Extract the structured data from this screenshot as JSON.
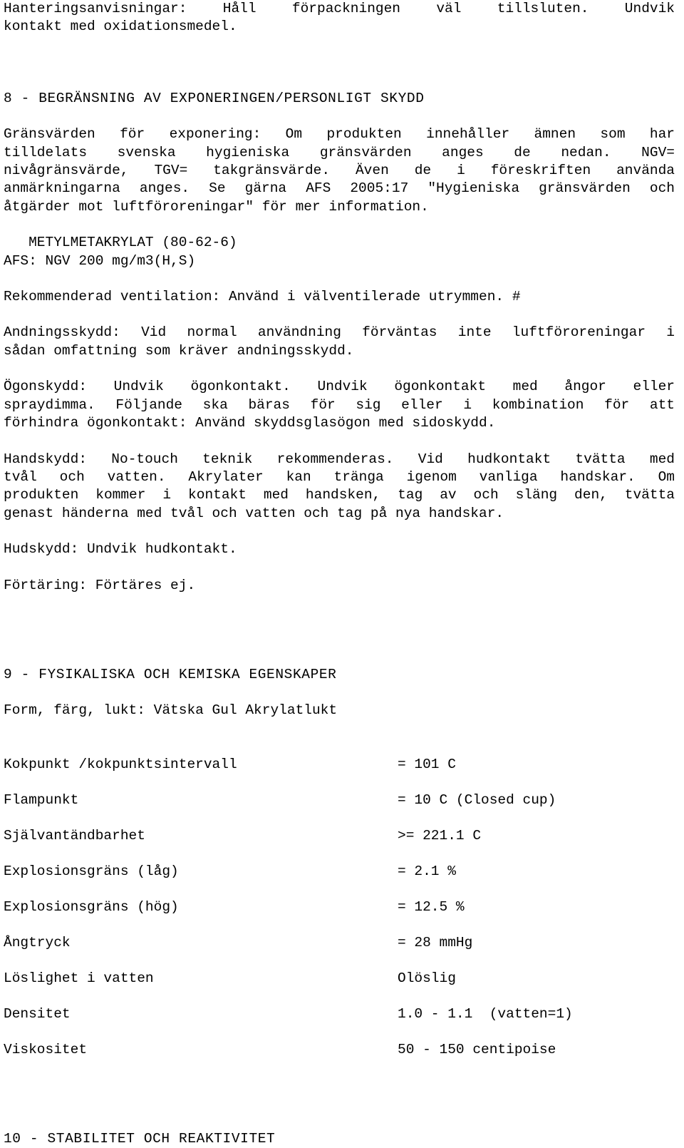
{
  "document": {
    "type": "safety-data-sheet",
    "language": "sv"
  },
  "top_paragraph": {
    "lines": [
      "Hanteringsanvisningar: Håll förpackningen väl tillsluten. Undvik",
      "kontakt med oxidationsmedel."
    ]
  },
  "section8": {
    "heading": "8 - BEGRÄNSNING AV EXPONERINGEN/PERSONLIGT SKYDD",
    "limits_paragraph": {
      "lines": [
        "Gränsvärden för exponering: Om produkten innehåller ämnen som har",
        "tilldelats svenska hygieniska gränsvärden anges de nedan. NGV=",
        "nivågränsvärde, TGV= takgränsvärde. Även de i föreskriften använda",
        "anmärkningarna anges. Se gärna AFS 2005:17 \"Hygieniska gränsvärden och",
        "åtgärder mot luftföroreningar\" för mer information."
      ]
    },
    "substance": {
      "name_line": "   METYLMETAKRYLAT (80-62-6)",
      "afs_line": "AFS: NGV 200 mg/m3(H,S)"
    },
    "ventilation": {
      "lines": [
        "Rekommenderad ventilation: Använd i välventilerade utrymmen. #"
      ]
    },
    "respiratory": {
      "lines": [
        "Andningsskydd: Vid normal användning förväntas inte luftföroreningar i",
        "sådan omfattning som kräver andningsskydd."
      ]
    },
    "eye": {
      "lines": [
        "Ögonskydd: Undvik ögonkontakt. Undvik ögonkontakt med ångor eller",
        "spraydimma. Följande ska bäras för sig eller i kombination för att",
        "förhindra ögonkontakt: Använd skyddsglasögon med sidoskydd."
      ]
    },
    "hand": {
      "lines": [
        "Handskydd: No-touch teknik rekommenderas. Vid hudkontakt tvätta med",
        "tvål och vatten. Akrylater kan tränga igenom vanliga handskar. Om",
        "produkten kommer i kontakt med handsken, tag av och släng den, tvätta",
        "genast händerna med tvål och vatten och tag på nya handskar."
      ]
    },
    "skin": {
      "lines": [
        "Hudskydd: Undvik hudkontakt."
      ]
    },
    "ingestion": {
      "lines": [
        "Förtäring: Förtäres ej."
      ]
    }
  },
  "section9": {
    "heading": "9 - FYSIKALISKA OCH KEMISKA EGENSKAPER",
    "form_line": "Form, färg, lukt: Vätska Gul Akrylatlukt",
    "properties": [
      {
        "label": "Kokpunkt /kokpunktsintervall",
        "value": "= 101 C"
      },
      {
        "label": "Flampunkt",
        "value": "= 10 C (Closed cup)"
      },
      {
        "label": "Självantändbarhet",
        "value": ">= 221.1 C"
      },
      {
        "label": "Explosionsgräns (låg)",
        "value": "= 2.1 %"
      },
      {
        "label": "Explosionsgräns (hög)",
        "value": "= 12.5 %"
      },
      {
        "label": "Ångtryck",
        "value": "= 28 mmHg"
      },
      {
        "label": "Löslighet i vatten",
        "value": "Olöslig"
      },
      {
        "label": "Densitet",
        "value": "1.0 - 1.1  (vatten=1)"
      },
      {
        "label": "Viskositet",
        "value": "50 - 150 centipoise"
      }
    ]
  },
  "section10": {
    "heading": "10 - STABILITET OCH REAKTIVITET"
  }
}
